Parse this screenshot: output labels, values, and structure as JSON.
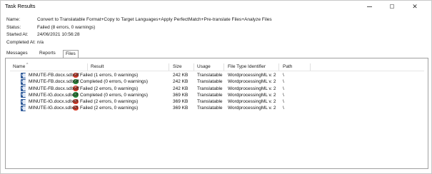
{
  "window": {
    "title": "Task Results",
    "close_glyph": "✕"
  },
  "info": {
    "name_label": "Name:",
    "name_value": "Convert to Translatable Format+Copy to Target Languages+Apply PerfectMatch+Pre-translate Files+Analyze Files",
    "status_label": "Status:",
    "status_value": "Failed (8 errors, 0 warnings)",
    "started_label": "Started At:",
    "started_value": "24/06/2021 10:56:28",
    "completed_label": "Completed At:",
    "completed_value": "n/a"
  },
  "tabs": [
    {
      "label": "Messages (8)"
    },
    {
      "label": "Reports (3)"
    },
    {
      "label": "Files"
    }
  ],
  "table": {
    "columns": {
      "name": "Name",
      "result": "Result",
      "size": "Size",
      "usage": "Usage",
      "type": "File Type Identifier",
      "path": "Path"
    },
    "sort_glyph": "^",
    "icon_letter": "W",
    "rows": [
      {
        "name": "MINUTE-FB.docx.sdlxliff",
        "status": "failed",
        "glyph": "✕",
        "result": "Failed (1 errors, 0 warnings)",
        "size": "242 KB",
        "usage": "Translatable",
        "type": "WordprocessingML v. 2",
        "path": "\\"
      },
      {
        "name": "MINUTE-FB.docx.sdlxliff",
        "status": "completed",
        "glyph": "✓",
        "result": "Completed (0 errors, 0 warnings)",
        "size": "242 KB",
        "usage": "Translatable",
        "type": "WordprocessingML v. 2",
        "path": "\\"
      },
      {
        "name": "MINUTE-FB.docx.sdlxliff",
        "status": "failed",
        "glyph": "✕",
        "result": "Failed (2 errors, 0 warnings)",
        "size": "242 KB",
        "usage": "Translatable",
        "type": "WordprocessingML v. 2",
        "path": "\\"
      },
      {
        "name": "MINUTE-IG.docx.sdlxliff",
        "status": "completed",
        "glyph": "✓",
        "result": "Completed (0 errors, 0 warnings)",
        "size": "369 KB",
        "usage": "Translatable",
        "type": "WordprocessingML v. 2",
        "path": "\\"
      },
      {
        "name": "MINUTE-IG.docx.sdlxliff",
        "status": "failed",
        "glyph": "✕",
        "result": "Failed (2 errors, 0 warnings)",
        "size": "369 KB",
        "usage": "Translatable",
        "type": "WordprocessingML v. 2",
        "path": "\\"
      },
      {
        "name": "MINUTE-IG.docx.sdlxliff",
        "status": "failed",
        "glyph": "✕",
        "result": "Failed (2 errors, 0 warnings)",
        "size": "369 KB",
        "usage": "Translatable",
        "type": "WordprocessingML v. 2",
        "path": "\\"
      }
    ]
  }
}
